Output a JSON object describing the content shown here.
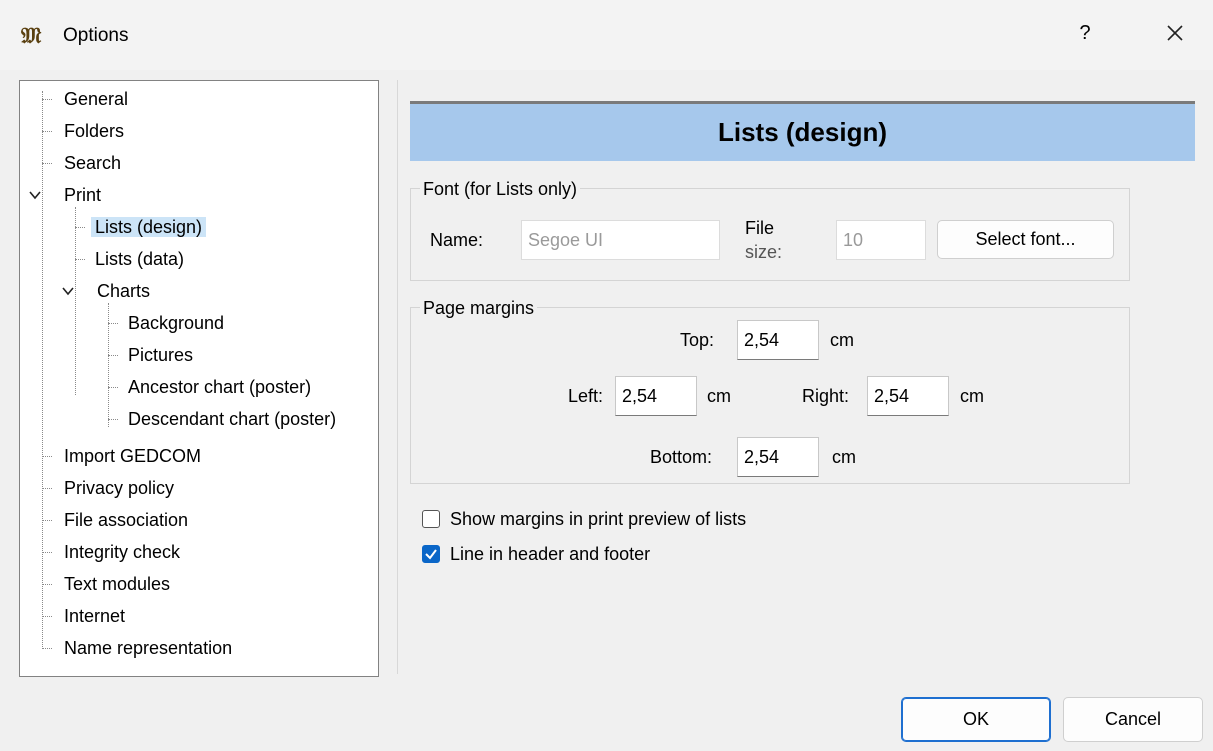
{
  "window": {
    "title": "Options",
    "app_icon_glyph": "𝔐",
    "help_label": "?"
  },
  "tree": {
    "items": [
      {
        "label": "General"
      },
      {
        "label": "Folders"
      },
      {
        "label": "Search"
      },
      {
        "label": "Print"
      },
      {
        "label": "Lists (design)"
      },
      {
        "label": "Lists (data)"
      },
      {
        "label": "Charts"
      },
      {
        "label": "Background"
      },
      {
        "label": "Pictures"
      },
      {
        "label": "Ancestor chart (poster)"
      },
      {
        "label": "Descendant chart (poster)"
      },
      {
        "label": "Import GEDCOM"
      },
      {
        "label": "Privacy policy"
      },
      {
        "label": "File association"
      },
      {
        "label": "Integrity check"
      },
      {
        "label": "Text modules"
      },
      {
        "label": "Internet"
      },
      {
        "label": "Name representation"
      }
    ]
  },
  "panel": {
    "title": "Lists (design)",
    "font_group": {
      "title": "Font (for Lists only)",
      "name_label": "Name:",
      "name_value": "Segoe UI",
      "size_label_line1": "File",
      "size_label_line2": "size:",
      "size_value": "10",
      "select_button": "Select font..."
    },
    "margins_group": {
      "title": "Page margins",
      "top_label": "Top:",
      "top_value": "2,54",
      "left_label": "Left:",
      "left_value": "2,54",
      "right_label": "Right:",
      "right_value": "2,54",
      "bottom_label": "Bottom:",
      "bottom_value": "2,54",
      "unit": "cm"
    },
    "show_margins": {
      "label": "Show margins in print preview of lists",
      "checked": false
    },
    "line_header_footer": {
      "label": "Line in header and footer",
      "checked": true
    }
  },
  "footer": {
    "ok_label": "OK",
    "cancel_label": "Cancel"
  },
  "colors": {
    "banner": "#a6c8ec",
    "selection": "#cce4f7",
    "accent": "#0a66c8"
  }
}
